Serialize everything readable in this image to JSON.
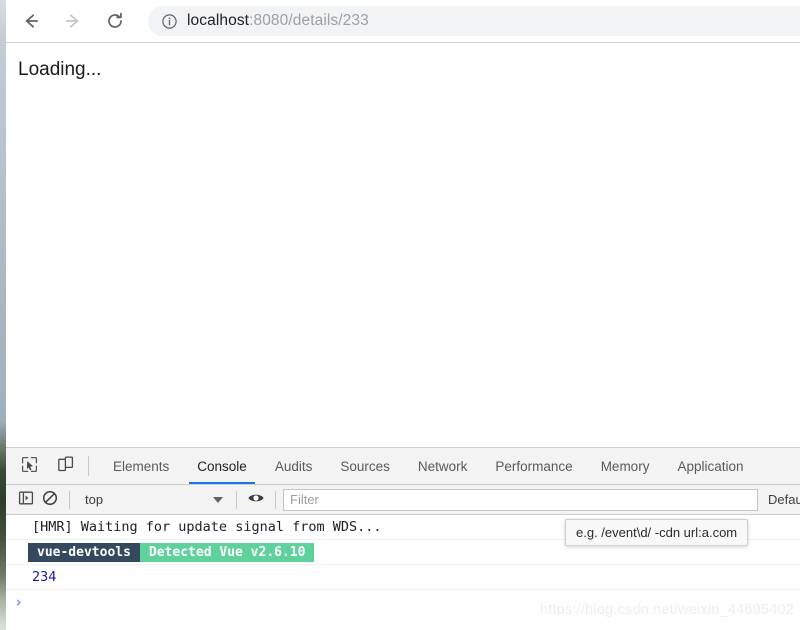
{
  "browser": {
    "back_icon": "arrow-left-icon",
    "forward_icon": "arrow-right-icon",
    "reload_icon": "reload-icon",
    "site_info_icon": "info-circle-icon",
    "url_host": "localhost",
    "url_path": ":8080/details/233",
    "url_full": "localhost:8080/details/233"
  },
  "page": {
    "body_text": "Loading..."
  },
  "devtools": {
    "inspect_icon": "inspect-element-icon",
    "device_toggle_icon": "device-toolbar-icon",
    "tabs": [
      {
        "label": "Elements",
        "active": false
      },
      {
        "label": "Console",
        "active": true
      },
      {
        "label": "Audits",
        "active": false
      },
      {
        "label": "Sources",
        "active": false
      },
      {
        "label": "Network",
        "active": false
      },
      {
        "label": "Performance",
        "active": false
      },
      {
        "label": "Memory",
        "active": false
      },
      {
        "label": "Application",
        "active": false
      }
    ],
    "console_toolbar": {
      "sidebar_toggle_icon": "console-sidebar-icon",
      "clear_icon": "clear-console-icon",
      "context_value": "top",
      "context_caret_icon": "chevron-down-icon",
      "live_expression_icon": "eye-icon",
      "filter_placeholder": "Filter",
      "filter_value": "",
      "levels_label": "Defau"
    },
    "messages": [
      {
        "type": "log",
        "text": "[HMR] Waiting for update signal from WDS..."
      }
    ],
    "vue_badge": {
      "name": "vue-devtools",
      "detail": "Detected Vue v2.6.10",
      "name_color": "#35495e",
      "detail_color": "#5ed19c"
    },
    "result_value": "234",
    "prompt_symbol": "›",
    "tooltip_text": "e.g. /event\\d/ -cdn url:a.com"
  },
  "watermark": {
    "text": "https://blog.csdn.net/weixin_44695402"
  },
  "colors": {
    "accent_tab_underline": "#1a73e8",
    "result_blue": "#1a1aa6",
    "omnibox_bg": "#f1f3f4"
  }
}
